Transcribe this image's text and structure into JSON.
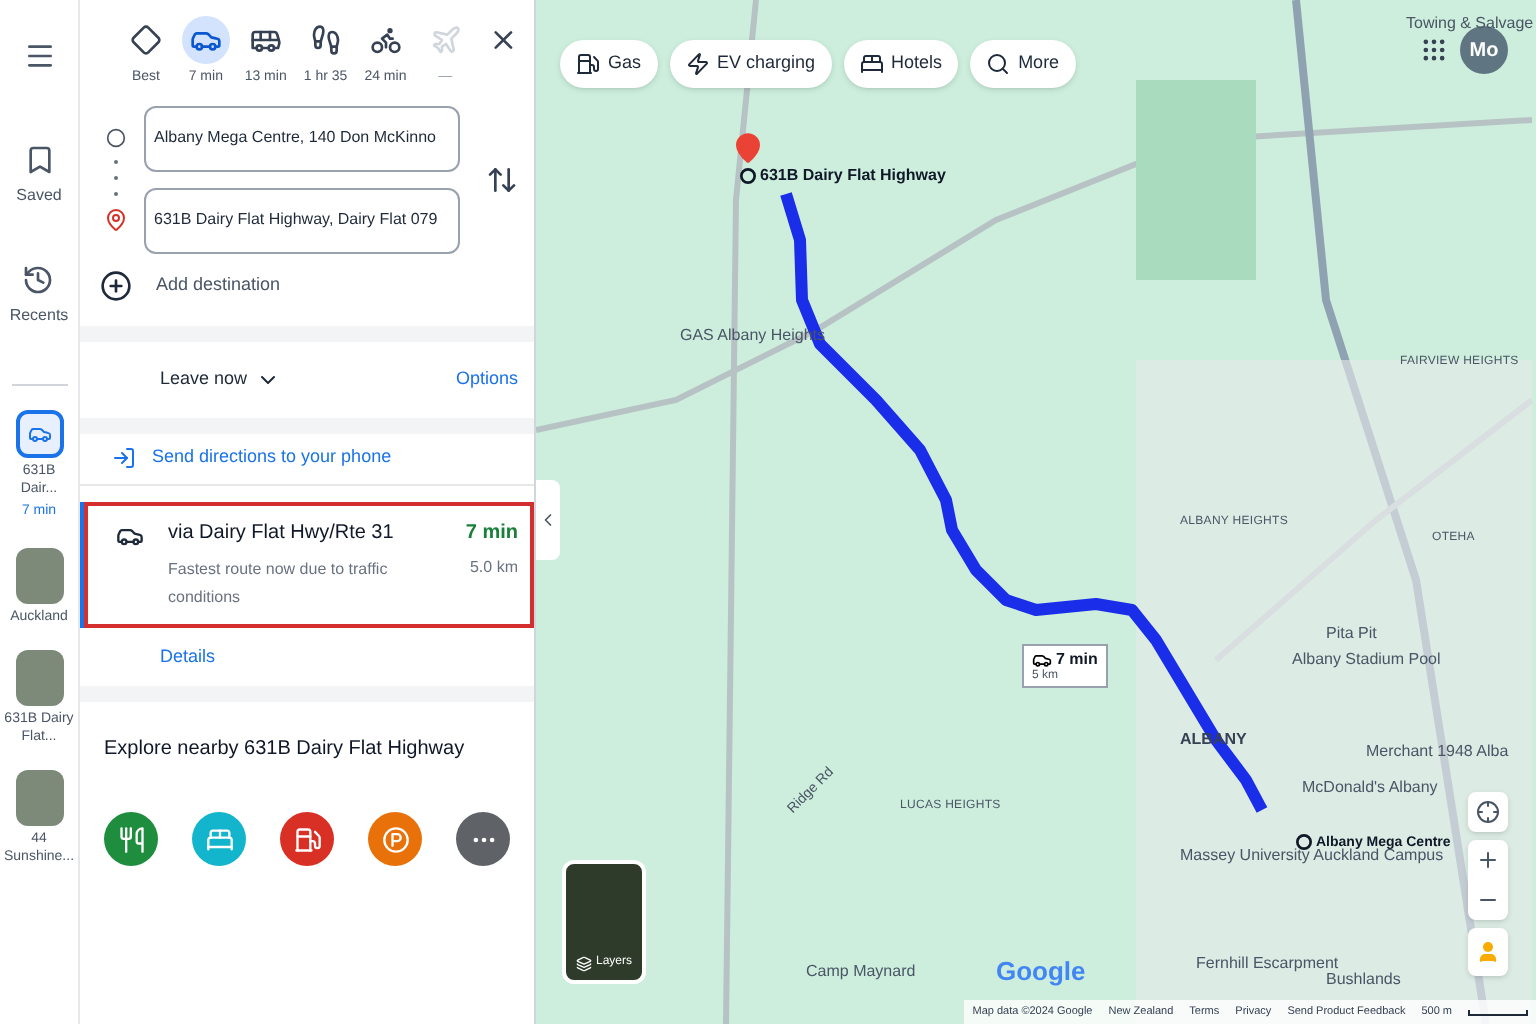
{
  "rail": {
    "saved": "Saved",
    "recents": "Recents",
    "items": [
      {
        "kind": "route",
        "label": "631B Dair...",
        "sub": "7 min",
        "selected": true
      },
      {
        "kind": "place",
        "label": "Auckland",
        "selected": false
      },
      {
        "kind": "place",
        "label": "631B Dairy Flat...",
        "selected": false
      },
      {
        "kind": "place",
        "label": "44 Sunshine...",
        "selected": false
      }
    ]
  },
  "modes": [
    {
      "kind": "best",
      "label": "Best",
      "selected": false
    },
    {
      "kind": "car",
      "label": "7 min",
      "selected": true
    },
    {
      "kind": "transit",
      "label": "13 min",
      "selected": false
    },
    {
      "kind": "walk",
      "label": "1 hr 35",
      "selected": false
    },
    {
      "kind": "bike",
      "label": "24 min",
      "selected": false
    },
    {
      "kind": "flight",
      "label": "—",
      "selected": false
    }
  ],
  "origin": "Albany Mega Centre, 140 Don McKinno",
  "destination": "631B Dairy Flat Highway, Dairy Flat 079",
  "add_destination": "Add destination",
  "leave": "Leave now",
  "options": "Options",
  "send": "Send directions to your phone",
  "route": {
    "title": "via Dairy Flat Hwy/Rte 31",
    "time": "7 min",
    "note": "Fastest route now due to traffic conditions",
    "distance": "5.0 km",
    "details": "Details",
    "selected": true
  },
  "explore": {
    "title": "Explore nearby 631B Dairy Flat Highway",
    "categories": [
      {
        "kind": "food",
        "color": "#1e8e3e"
      },
      {
        "kind": "hotel",
        "color": "#12b5cb"
      },
      {
        "kind": "gas",
        "color": "#d93025"
      },
      {
        "kind": "parking",
        "color": "#e8710a"
      },
      {
        "kind": "more",
        "color": "#5f6368"
      }
    ]
  },
  "chips": [
    {
      "kind": "gas",
      "label": "Gas"
    },
    {
      "kind": "ev",
      "label": "EV charging"
    },
    {
      "kind": "hotel",
      "label": "Hotels"
    },
    {
      "kind": "search",
      "label": "More"
    }
  ],
  "avatar": "Mo",
  "labels": [
    {
      "kind": "poi",
      "text": "Towing & Salvage"
    },
    {
      "kind": "dest",
      "text": "631B Dairy Flat Highway"
    },
    {
      "kind": "poi",
      "text": "GAS Albany Heights"
    },
    {
      "kind": "area",
      "text": "FAIRVIEW HEIGHTS"
    },
    {
      "kind": "area",
      "text": "ALBANY HEIGHTS"
    },
    {
      "kind": "area",
      "text": "OTEHA"
    },
    {
      "kind": "poi",
      "text": "Pita Pit"
    },
    {
      "kind": "poi",
      "text": "Albany Stadium Pool"
    },
    {
      "kind": "town",
      "text": "ALBANY"
    },
    {
      "kind": "poi",
      "text": "Merchant 1948 Alba"
    },
    {
      "kind": "poi",
      "text": "McDonald's Albany"
    },
    {
      "kind": "origin",
      "text": "Albany Mega Centre"
    },
    {
      "kind": "area",
      "text": "LUCAS HEIGHTS"
    },
    {
      "kind": "poi",
      "text": "Massey University Auckland Campus"
    },
    {
      "kind": "poi",
      "text": "Fernhill Escarpment"
    },
    {
      "kind": "poi",
      "text": "Bushlands"
    },
    {
      "kind": "poi",
      "text": "Camp Maynard"
    },
    {
      "kind": "road",
      "text": "Ridge Rd"
    }
  ],
  "route_badge": {
    "time": "7 min",
    "distance": "5 km"
  },
  "layers": "Layers",
  "logo": "Google",
  "footer": [
    "Map data ©2024 Google",
    "New Zealand",
    "Terms",
    "Privacy",
    "Send Product Feedback"
  ],
  "scale": "500 m"
}
